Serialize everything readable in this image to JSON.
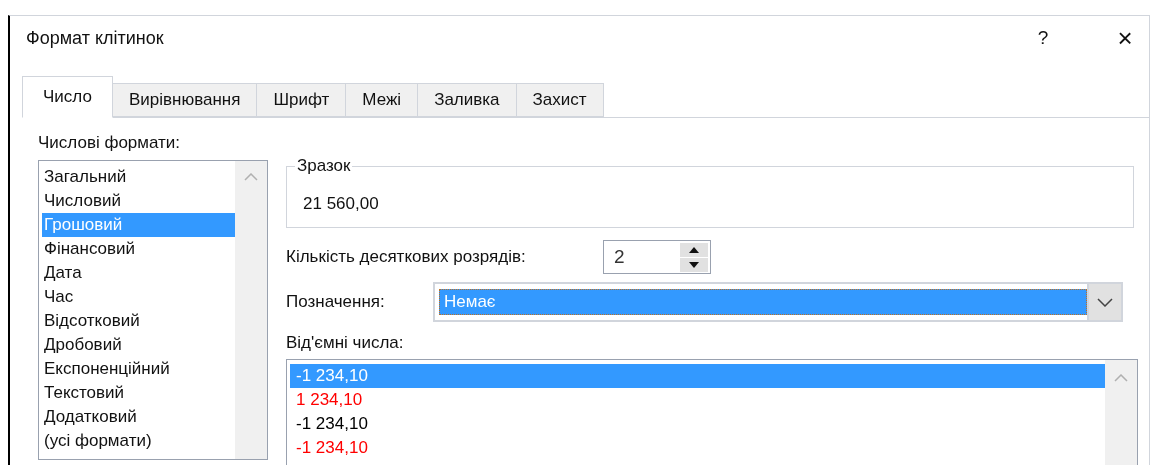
{
  "window": {
    "title": "Формат клітинок",
    "help_button": "?",
    "close_button": "×"
  },
  "tabs": [
    {
      "label": "Число",
      "selected": true
    },
    {
      "label": "Вирівнювання",
      "selected": false
    },
    {
      "label": "Шрифт",
      "selected": false
    },
    {
      "label": "Межі",
      "selected": false
    },
    {
      "label": "Заливка",
      "selected": false
    },
    {
      "label": "Захист",
      "selected": false
    }
  ],
  "category": {
    "label": "Числові формати:",
    "items": [
      {
        "label": "Загальний",
        "selected": false
      },
      {
        "label": "Числовий",
        "selected": false
      },
      {
        "label": "Грошовий",
        "selected": true
      },
      {
        "label": "Фінансовий",
        "selected": false
      },
      {
        "label": "Дата",
        "selected": false
      },
      {
        "label": "Час",
        "selected": false
      },
      {
        "label": "Відсотковий",
        "selected": false
      },
      {
        "label": "Дробовий",
        "selected": false
      },
      {
        "label": "Експоненційний",
        "selected": false
      },
      {
        "label": "Текстовий",
        "selected": false
      },
      {
        "label": "Додатковий",
        "selected": false
      },
      {
        "label": "(усі формати)",
        "selected": false
      }
    ]
  },
  "sample": {
    "label": "Зразок",
    "value": "21 560,00"
  },
  "decimal_places": {
    "label": "Кількість десяткових розрядів:",
    "value": "2"
  },
  "symbol": {
    "label": "Позначення:",
    "value": "Немає"
  },
  "negative_numbers": {
    "label": "Від'ємні числа:",
    "items": [
      {
        "label": "-1 234,10",
        "selected": true
      },
      {
        "label": "1 234,10",
        "selected": false,
        "color": "#ff0000"
      },
      {
        "label": "-1 234,10",
        "selected": false,
        "color": "#000000"
      },
      {
        "label": "-1 234,10",
        "selected": false,
        "color": "#ff0000"
      }
    ]
  }
}
